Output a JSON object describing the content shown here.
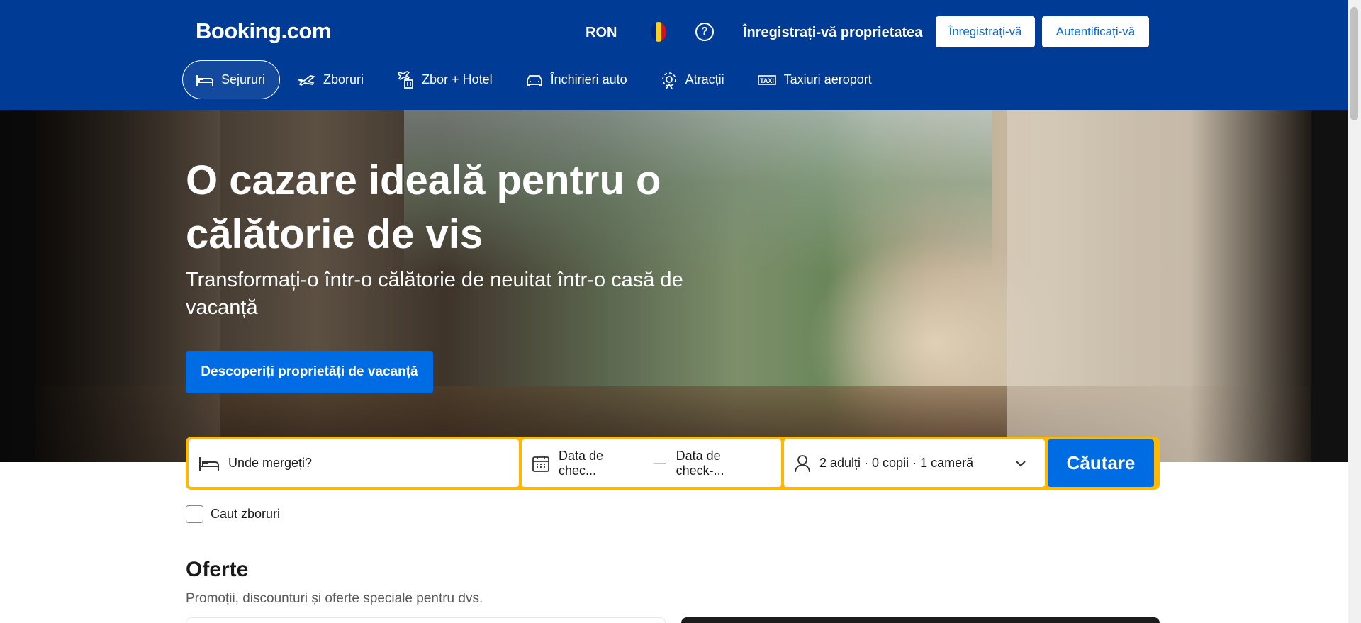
{
  "header": {
    "logo": "Booking.com",
    "currency": "RON",
    "list_property": "Înregistrați-vă proprietatea",
    "register": "Înregistrați-vă",
    "sign_in": "Autentificați-vă"
  },
  "nav": {
    "items": [
      {
        "label": "Sejururi",
        "icon": "bed-icon"
      },
      {
        "label": "Zboruri",
        "icon": "plane-icon"
      },
      {
        "label": "Zbor + Hotel",
        "icon": "flight-hotel-icon"
      },
      {
        "label": "Închirieri auto",
        "icon": "car-icon"
      },
      {
        "label": "Atracții",
        "icon": "attractions-icon"
      },
      {
        "label": "Taxiuri aeroport",
        "icon": "taxi-icon"
      }
    ]
  },
  "hero": {
    "title": "O cazare ideală pentru o călătorie de vis",
    "subtitle": "Transformați-o într-o călătorie de neuitat într-o casă de vacanță",
    "cta": "Descoperiți proprietăți de vacanță"
  },
  "search": {
    "destination_placeholder": "Unde mergeți?",
    "checkin": "Data de chec...",
    "checkout": "Data de check-...",
    "guests": "2 adulți · 0 copii · 1 cameră",
    "button": "Căutare"
  },
  "flights_checkbox": "Caut zboruri",
  "offers": {
    "title": "Oferte",
    "subtitle": "Promoții, discounturi și oferte speciale pentru dvs."
  },
  "colors": {
    "brand_blue": "#003b95",
    "action_blue": "#006ce4",
    "search_yellow": "#ffb700"
  }
}
